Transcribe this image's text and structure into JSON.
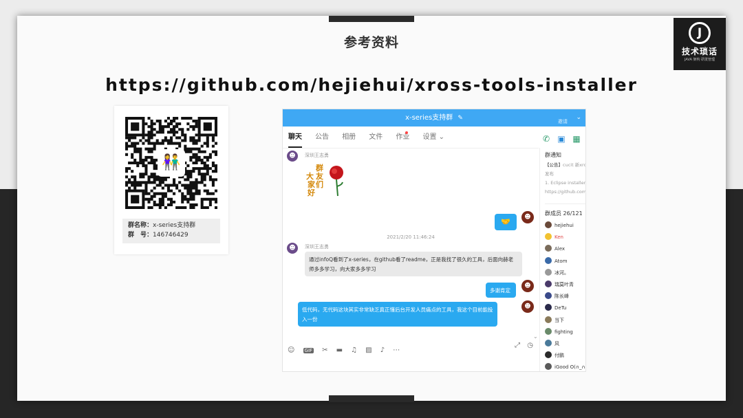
{
  "slide": {
    "title": "参考资料",
    "url": "https://github.com/hejiehui/xross-tools-installer"
  },
  "logo": {
    "mark": "J",
    "name": "技术琐话",
    "sub": "JAVA 架构 研发管理"
  },
  "qr_card": {
    "group_name_label": "群名称：",
    "group_name": "x-series支持群",
    "group_id_label": "群　号：",
    "group_id": "146746429"
  },
  "chat": {
    "header": {
      "title": "x-series支持群",
      "edit_icon": "pencil-icon",
      "button": "邀请"
    },
    "tabs": [
      {
        "label": "聊天",
        "active": true
      },
      {
        "label": "公告"
      },
      {
        "label": "相册"
      },
      {
        "label": "文件"
      },
      {
        "label": "作业",
        "badge": true
      },
      {
        "label": "设置 ⌄"
      }
    ],
    "messages": {
      "m1_sender": "深圳王志勇",
      "sticker_text": [
        "群",
        "友",
        "们",
        "大",
        "家",
        "好"
      ],
      "reply_emoji": "🤝",
      "timestamp": "2021/2/20 11:46:24",
      "m2_sender": "深圳王志勇",
      "m2_text": "通过infoQ看到了x-series，在github看了readme，正是我找了很久的工具，后面向赫老师多多学习，向大家多多学习",
      "m3_text": "多谢肯定",
      "m4_text": "低代码，无代码这块其实非常缺乏真正懂后台开发人员痛点的工具，我这个目前能投入一份"
    },
    "toolbar": {
      "icons": [
        "emoji-icon",
        "gif-icon",
        "scissors-icon",
        "folder-icon",
        "music-icon",
        "image-icon",
        "bell-icon",
        "more-icon"
      ],
      "right_icons": [
        "expand-icon",
        "history-icon"
      ]
    },
    "sidebar": {
      "notice_title": "群通知",
      "notice_line1_strong": "【公告】",
      "notice_line1": "cucit 新xross",
      "notice_line2": "发布",
      "notice_line3": "1. Eclipse installer",
      "notice_line4": "https://github.com",
      "members_title": "群成员 26/121",
      "members": [
        {
          "name": "hejiehui",
          "color": "#6a4a3a"
        },
        {
          "name": "Ken",
          "color": "#f2c230",
          "red": true
        },
        {
          "name": "Alex",
          "color": "#7a6b5a"
        },
        {
          "name": "Atom",
          "color": "#3a6aa8"
        },
        {
          "name": "冰河。",
          "color": "#999999"
        },
        {
          "name": "瑞莫叶青",
          "color": "#4a3a6a"
        },
        {
          "name": "陈长峰",
          "color": "#3a4a8a"
        },
        {
          "name": "DeTu",
          "color": "#2a2a4a"
        },
        {
          "name": "当下",
          "color": "#8a7a5a"
        },
        {
          "name": "fighting",
          "color": "#6a8a6a"
        },
        {
          "name": "风",
          "color": "#4a7a9a"
        },
        {
          "name": "付鹏",
          "color": "#2a2a2a"
        },
        {
          "name": "iGood O(∩_∩",
          "color": "#5a5a5a"
        }
      ]
    }
  }
}
